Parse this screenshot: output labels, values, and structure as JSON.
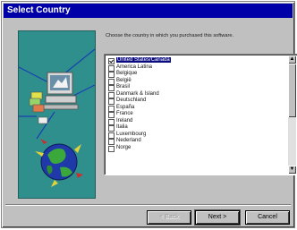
{
  "window": {
    "title": "Select Country"
  },
  "instruction": "Choose the country in which you purchased this software.",
  "country_list": {
    "items": [
      {
        "label": "United States/Canada",
        "selected": true
      },
      {
        "label": "America Latina",
        "selected": false
      },
      {
        "label": "Belgique",
        "selected": false
      },
      {
        "label": "België",
        "selected": false
      },
      {
        "label": "Brasil",
        "selected": false
      },
      {
        "label": "Danmark & Island",
        "selected": false
      },
      {
        "label": "Deutschland",
        "selected": false
      },
      {
        "label": "España",
        "selected": false
      },
      {
        "label": "France",
        "selected": false
      },
      {
        "label": "Ireland",
        "selected": false
      },
      {
        "label": "Italia",
        "selected": false
      },
      {
        "label": "Luxembourg",
        "selected": false
      },
      {
        "label": "Nederland",
        "selected": false
      },
      {
        "label": "Norge",
        "selected": false
      }
    ]
  },
  "buttons": {
    "back": "< Back",
    "next": "Next >",
    "cancel": "Cancel"
  },
  "colors": {
    "title_bar": "#0000a8",
    "selection": "#0a0a80",
    "art_panel": "#2f8f8c"
  },
  "icons": {
    "art_panel": "computer-and-globe-illustration",
    "scroll_up": "scroll-up-arrow-icon",
    "scroll_down": "scroll-down-arrow-icon"
  }
}
